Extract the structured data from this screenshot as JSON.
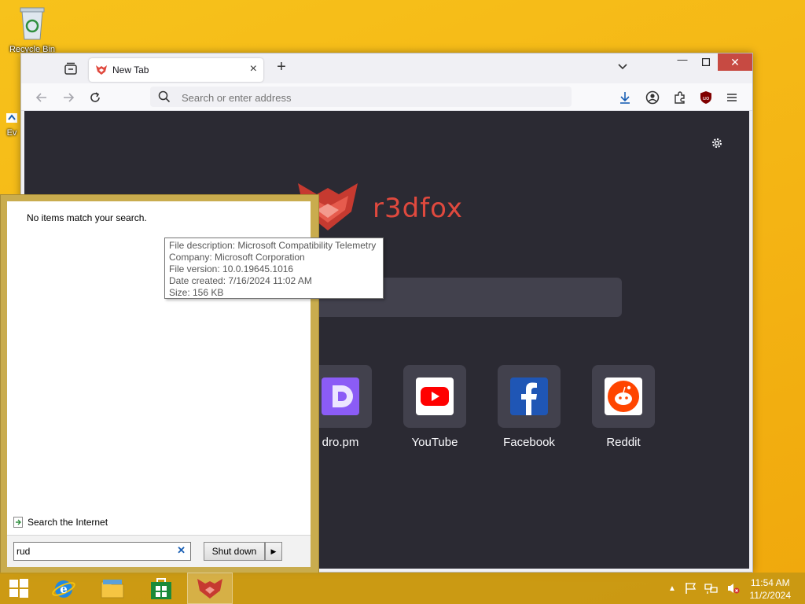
{
  "desktop": {
    "icons": [
      {
        "label": "Recycle Bin"
      },
      {
        "label": "Ev"
      }
    ]
  },
  "browser": {
    "tab": {
      "title": "New Tab"
    },
    "address_placeholder": "Search or enter address",
    "brand": "r3dfox",
    "shortcuts": [
      {
        "label": "dro.pm",
        "color": "#8b5cf6"
      },
      {
        "label": "YouTube",
        "color": "#ff0000"
      },
      {
        "label": "Facebook",
        "color": "#1877f2"
      },
      {
        "label": "Reddit",
        "color": "#ff4500"
      }
    ]
  },
  "start_menu": {
    "no_items": "No items match your search.",
    "search_internet": "Search the Internet",
    "search_value": "rud",
    "shutdown_label": "Shut down"
  },
  "tooltip": {
    "lines": [
      "File description: Microsoft Compatibility Telemetry",
      "Company: Microsoft Corporation",
      "File version: 10.0.19645.1016",
      "Date created: 7/16/2024 11:02 AM",
      "Size: 156 KB"
    ]
  },
  "taskbar": {
    "time": "11:54 AM",
    "date": "11/2/2024"
  }
}
